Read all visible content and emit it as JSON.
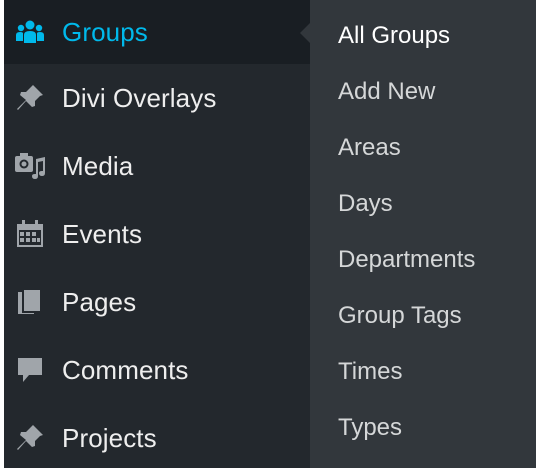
{
  "colors": {
    "menu_bg": "#23282d",
    "menu_active_bg": "#191e23",
    "submenu_bg": "#32373c",
    "active_text": "#00b9eb",
    "menu_text": "#eeeeee",
    "submenu_text": "#d5d7d8",
    "icon": "#a0a5aa"
  },
  "menu": {
    "items": [
      {
        "label": "Groups",
        "icon": "groups-icon",
        "active": true
      },
      {
        "label": "Divi Overlays",
        "icon": "pin-icon",
        "active": false
      },
      {
        "label": "Media",
        "icon": "media-icon",
        "active": false
      },
      {
        "label": "Events",
        "icon": "calendar-icon",
        "active": false
      },
      {
        "label": "Pages",
        "icon": "pages-icon",
        "active": false
      },
      {
        "label": "Comments",
        "icon": "comment-icon",
        "active": false
      },
      {
        "label": "Projects",
        "icon": "pin-icon",
        "active": false
      }
    ]
  },
  "submenu": {
    "items": [
      {
        "label": "All Groups"
      },
      {
        "label": "Add New"
      },
      {
        "label": "Areas"
      },
      {
        "label": "Days"
      },
      {
        "label": "Departments"
      },
      {
        "label": "Group Tags"
      },
      {
        "label": "Times"
      },
      {
        "label": "Types"
      }
    ]
  }
}
